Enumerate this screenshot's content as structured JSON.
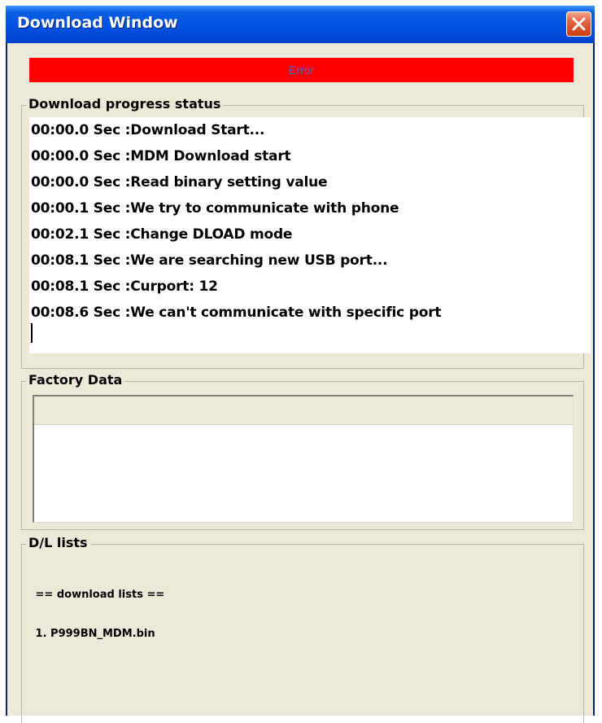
{
  "window": {
    "title": "Download Window",
    "close_icon": "close-icon"
  },
  "status": {
    "label": "Error",
    "color": "#ff0000"
  },
  "progress": {
    "group_label": "Download progress status",
    "lines": [
      "00:00.0 Sec :Download Start...",
      "00:00.0 Sec :MDM Download start",
      "00:00.0 Sec :Read binary setting value",
      "00:00.1 Sec :We try to communicate with phone",
      "00:02.1 Sec :Change DLOAD mode",
      "00:08.1 Sec :We are searching new USB port...",
      "00:08.1 Sec :Curport: 12",
      "00:08.6 Sec :We can't communicate with specific port"
    ]
  },
  "factory": {
    "group_label": "Factory Data"
  },
  "dl_lists": {
    "group_label": "D/L lists",
    "lines": [
      " == download lists ==",
      " 1. P999BN_MDM.bin"
    ]
  }
}
